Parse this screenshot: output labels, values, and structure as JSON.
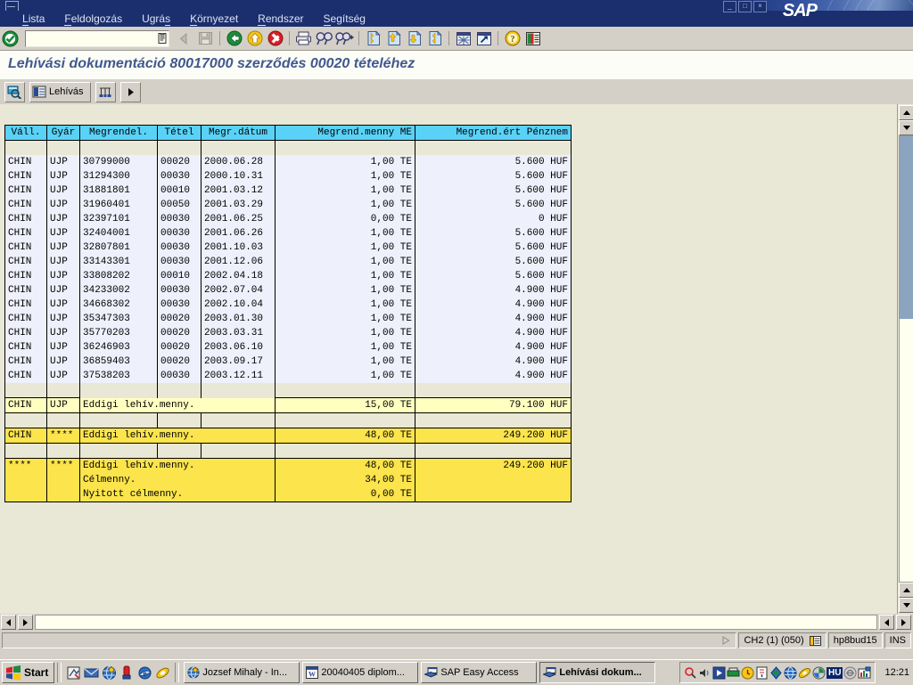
{
  "window": {
    "sap_logo": "SAP",
    "controls": {
      "minimize": "_",
      "maximize": "□",
      "close": "×"
    }
  },
  "menubar": {
    "items": [
      {
        "label": "Lista",
        "accel": "L"
      },
      {
        "label": "Feldolgozás",
        "accel": "F"
      },
      {
        "label": "Ugrás",
        "accel": "s"
      },
      {
        "label": "Környezet",
        "accel": "K"
      },
      {
        "label": "Rendszer",
        "accel": "R"
      },
      {
        "label": "Segítség",
        "accel": "S"
      }
    ]
  },
  "toolbar": {
    "command_value": "",
    "command_placeholder": "",
    "buttons": [
      {
        "name": "enter-icon",
        "title": "Enter"
      },
      {
        "name": "back-grey-icon",
        "title": "Vissza"
      },
      {
        "name": "save-grey-icon",
        "title": "Mentés"
      },
      {
        "name": "back-green-icon",
        "title": "Vissza"
      },
      {
        "name": "exit-yellow-icon",
        "title": "Kilépés"
      },
      {
        "name": "cancel-red-icon",
        "title": "Mégse"
      },
      {
        "name": "print-icon",
        "title": "Nyomtatás"
      },
      {
        "name": "find-icon",
        "title": "Keresés"
      },
      {
        "name": "find-next-icon",
        "title": "Következő keresése"
      },
      {
        "name": "first-page-icon",
        "title": "Első oldal"
      },
      {
        "name": "prev-page-icon",
        "title": "Előző oldal"
      },
      {
        "name": "next-page-icon",
        "title": "Következő oldal"
      },
      {
        "name": "last-page-icon",
        "title": "Utolsó oldal"
      },
      {
        "name": "new-session-icon",
        "title": "Új mód"
      },
      {
        "name": "shortcut-icon",
        "title": "Parancsikon"
      },
      {
        "name": "help-icon",
        "title": "Súgó"
      },
      {
        "name": "layout-menu-icon",
        "title": "Elrendezés"
      }
    ]
  },
  "page": {
    "title": "Lehívási dokumentáció 80017000 szerződés 00020 tételéhez"
  },
  "apptoolbar": {
    "buttons": [
      {
        "name": "detail-icon",
        "label": ""
      },
      {
        "name": "lehivas-button",
        "label": "Lehívás"
      },
      {
        "name": "sort-icon",
        "label": ""
      },
      {
        "name": "more-icon",
        "label": ""
      }
    ],
    "lehivas_label": "Lehívás"
  },
  "table": {
    "headers": [
      "Váll.",
      "Gyár",
      "Megrendel.",
      "Tétel",
      "Megr.dátum",
      "Megrend.menny ME",
      "Megrend.ért Pénznem"
    ],
    "rows": [
      [
        "CHIN",
        "UJP",
        "30799000",
        "00020",
        "2000.06.28",
        "1,00 TE",
        "5.600 HUF"
      ],
      [
        "CHIN",
        "UJP",
        "31294300",
        "00030",
        "2000.10.31",
        "1,00 TE",
        "5.600 HUF"
      ],
      [
        "CHIN",
        "UJP",
        "31881801",
        "00010",
        "2001.03.12",
        "1,00 TE",
        "5.600 HUF"
      ],
      [
        "CHIN",
        "UJP",
        "31960401",
        "00050",
        "2001.03.29",
        "1,00 TE",
        "5.600 HUF"
      ],
      [
        "CHIN",
        "UJP",
        "32397101",
        "00030",
        "2001.06.25",
        "0,00 TE",
        "0 HUF"
      ],
      [
        "CHIN",
        "UJP",
        "32404001",
        "00030",
        "2001.06.26",
        "1,00 TE",
        "5.600 HUF"
      ],
      [
        "CHIN",
        "UJP",
        "32807801",
        "00030",
        "2001.10.03",
        "1,00 TE",
        "5.600 HUF"
      ],
      [
        "CHIN",
        "UJP",
        "33143301",
        "00030",
        "2001.12.06",
        "1,00 TE",
        "5.600 HUF"
      ],
      [
        "CHIN",
        "UJP",
        "33808202",
        "00010",
        "2002.04.18",
        "1,00 TE",
        "5.600 HUF"
      ],
      [
        "CHIN",
        "UJP",
        "34233002",
        "00030",
        "2002.07.04",
        "1,00 TE",
        "4.900 HUF"
      ],
      [
        "CHIN",
        "UJP",
        "34668302",
        "00030",
        "2002.10.04",
        "1,00 TE",
        "4.900 HUF"
      ],
      [
        "CHIN",
        "UJP",
        "35347303",
        "00020",
        "2003.01.30",
        "1,00 TE",
        "4.900 HUF"
      ],
      [
        "CHIN",
        "UJP",
        "35770203",
        "00020",
        "2003.03.31",
        "1,00 TE",
        "4.900 HUF"
      ],
      [
        "CHIN",
        "UJP",
        "36246903",
        "00020",
        "2003.06.10",
        "1,00 TE",
        "4.900 HUF"
      ],
      [
        "CHIN",
        "UJP",
        "36859403",
        "00020",
        "2003.09.17",
        "1,00 TE",
        "4.900 HUF"
      ],
      [
        "CHIN",
        "UJP",
        "37538203",
        "00030",
        "2003.12.11",
        "1,00 TE",
        "4.900 HUF"
      ]
    ],
    "subtotal_plant": {
      "vall": "CHIN",
      "gyar": "UJP",
      "label": "Eddigi lehív.menny.",
      "menny": "15,00 TE",
      "ert": "79.100 HUF"
    },
    "subtotal_company": {
      "vall": "CHIN",
      "gyar": "****",
      "label": "Eddigi lehív.menny.",
      "menny": "48,00 TE",
      "ert": "249.200 HUF"
    },
    "grand_total": {
      "vall": "****",
      "gyar": "****",
      "lines": [
        {
          "label": "Eddigi lehív.menny.",
          "menny": "48,00 TE",
          "ert": "249.200 HUF"
        },
        {
          "label": "Célmenny.",
          "menny": "34,00 TE",
          "ert": ""
        },
        {
          "label": "Nyitott célmenny.",
          "menny": "0,00 TE",
          "ert": ""
        }
      ]
    }
  },
  "statusbar": {
    "message": "",
    "system": "CH2 (1) (050)",
    "host": "hp8bud15",
    "insert_mode": "INS"
  },
  "taskbar": {
    "start_label": "Start",
    "quicklaunch": [
      {
        "name": "show-desktop-icon"
      },
      {
        "name": "mail-icon"
      },
      {
        "name": "browser-globe-icon"
      },
      {
        "name": "media-icon"
      },
      {
        "name": "internet-explorer-icon"
      },
      {
        "name": "netscape-icon"
      }
    ],
    "tasks": [
      {
        "name": "taskbtn-jozsef-mihaly",
        "label": "Jozsef Mihaly - In...",
        "icon": "browser-globe-icon",
        "active": false
      },
      {
        "name": "taskbtn-word-doc",
        "label": "20040405 diplom...",
        "icon": "word-icon",
        "active": false
      },
      {
        "name": "taskbtn-sap-easy-access",
        "label": "SAP Easy Access",
        "icon": "sap-window-icon",
        "active": false
      },
      {
        "name": "taskbtn-lehivasi-dokum",
        "label": "Lehívási dokum...",
        "icon": "sap-window-icon",
        "active": true
      }
    ],
    "tray": [
      {
        "name": "tray-magnifier-icon"
      },
      {
        "name": "tray-volume-icon"
      },
      {
        "name": "tray-media-play-icon"
      },
      {
        "name": "tray-printer-icon"
      },
      {
        "name": "tray-clock-app-icon"
      },
      {
        "name": "tray-notes-icon"
      },
      {
        "name": "tray-network-icon"
      },
      {
        "name": "tray-globe-icon"
      },
      {
        "name": "tray-comet-icon"
      },
      {
        "name": "tray-shield-icon"
      },
      {
        "name": "tray-language-hu-icon"
      },
      {
        "name": "tray-disabled-icon"
      },
      {
        "name": "tray-chart-icon"
      }
    ],
    "language": "HU",
    "clock": "12:21"
  },
  "colors": {
    "titlebar": "#1b2f6e",
    "header_cell": "#5ad2f7",
    "data_cell": "#eef0fb",
    "canvas": "#e9e8d6",
    "subtotal_light": "#ffffc0",
    "subtotal_strong": "#fbe44c",
    "title_text": "#41598f",
    "chrome": "#d4d0c8"
  }
}
